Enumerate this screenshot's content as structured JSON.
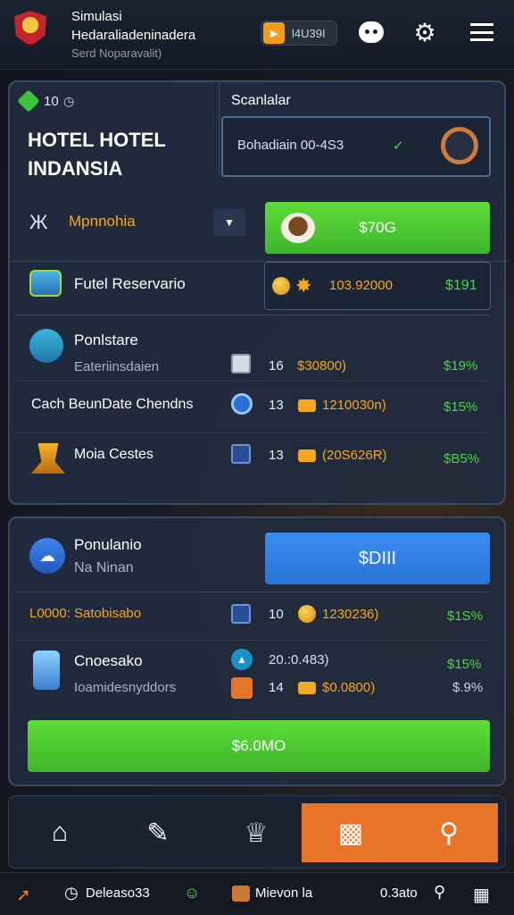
{
  "header": {
    "title_line1": "Simulasi",
    "title_line2": "Hedaraliadeninadera",
    "subtitle": "Serd Noparavalit)",
    "badge_text": "l4U39I",
    "badge_play_icon": "play-icon",
    "icons": [
      "bot-face-icon",
      "gear-icon",
      "hamburger-menu-icon"
    ]
  },
  "hotel_panel": {
    "counter_value": "10",
    "hotel_name_line1": "HOTEL HOTEL",
    "hotel_name_line2": "INDANSIA",
    "scan_label": "Scanlalar",
    "scan_box_text": "Bohadiain 00-4S3",
    "category_label": "Mpnnohia",
    "coffee_button_label": "$70G",
    "reservation_label": "Futel Reservario",
    "reservation_amount": "103.92000",
    "reservation_price": "$191"
  },
  "list_section": {
    "header_title": "Ponlstare",
    "header_subtitle": "Eateriinsdaien",
    "rows": [
      {
        "label": "",
        "qty": "16",
        "amount": "$30800)",
        "pct": "$19%"
      },
      {
        "label": "Cach BeunDate Chendns",
        "qty": "13",
        "amount": "1210030n)",
        "pct": "$15%"
      },
      {
        "label": "Moia Cestes",
        "qty": "13",
        "amount": "(20S626R)",
        "pct": "$B5%"
      }
    ]
  },
  "population_panel": {
    "title": "Ponulanio",
    "subtitle": "Na Ninan",
    "button_label": "$DIII",
    "rows": [
      {
        "label": "L0000: Satobisabo",
        "qty": "10",
        "amount": "1230236)",
        "pct": "$1S%"
      },
      {
        "label": "Cnoesako",
        "qty": "20.:0.483)",
        "amount": "",
        "pct": "$15%"
      },
      {
        "label": "Ioamidesnyddors",
        "qty": "14",
        "amount": "$0.0800)",
        "pct": "$.9%"
      }
    ],
    "footer_button_label": "$6.0MO"
  },
  "bottom_nav": {
    "items": [
      "home-icon",
      "edit-icon",
      "trophy-icon",
      "card-icon",
      "search-icon"
    ],
    "active_index": 3
  },
  "status_bar": {
    "item1": "Deleaso33",
    "item2": "Mievon la",
    "item3": "0.3ato"
  }
}
